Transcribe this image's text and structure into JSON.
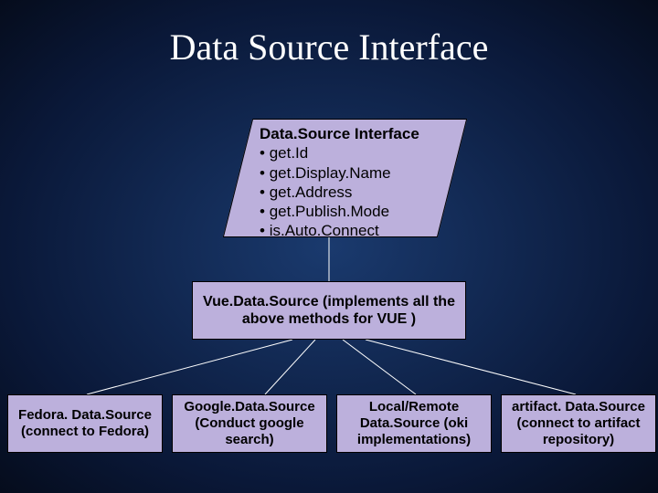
{
  "title": "Data Source Interface",
  "interface": {
    "header": "Data.Source Interface",
    "methods": [
      "get.Id",
      "get.Display.Name",
      "get.Address",
      "get.Publish.Mode",
      "is.Auto.Connect"
    ]
  },
  "vue_box": "Vue.Data.Source\n(implements all the above methods for VUE )",
  "leaves": [
    "Fedora. Data.Source (connect to Fedora)",
    "Google.Data.Source (Conduct google search)",
    "Local/Remote Data.Source\n(oki implementations)",
    "artifact. Data.Source (connect to artifact repository)"
  ]
}
